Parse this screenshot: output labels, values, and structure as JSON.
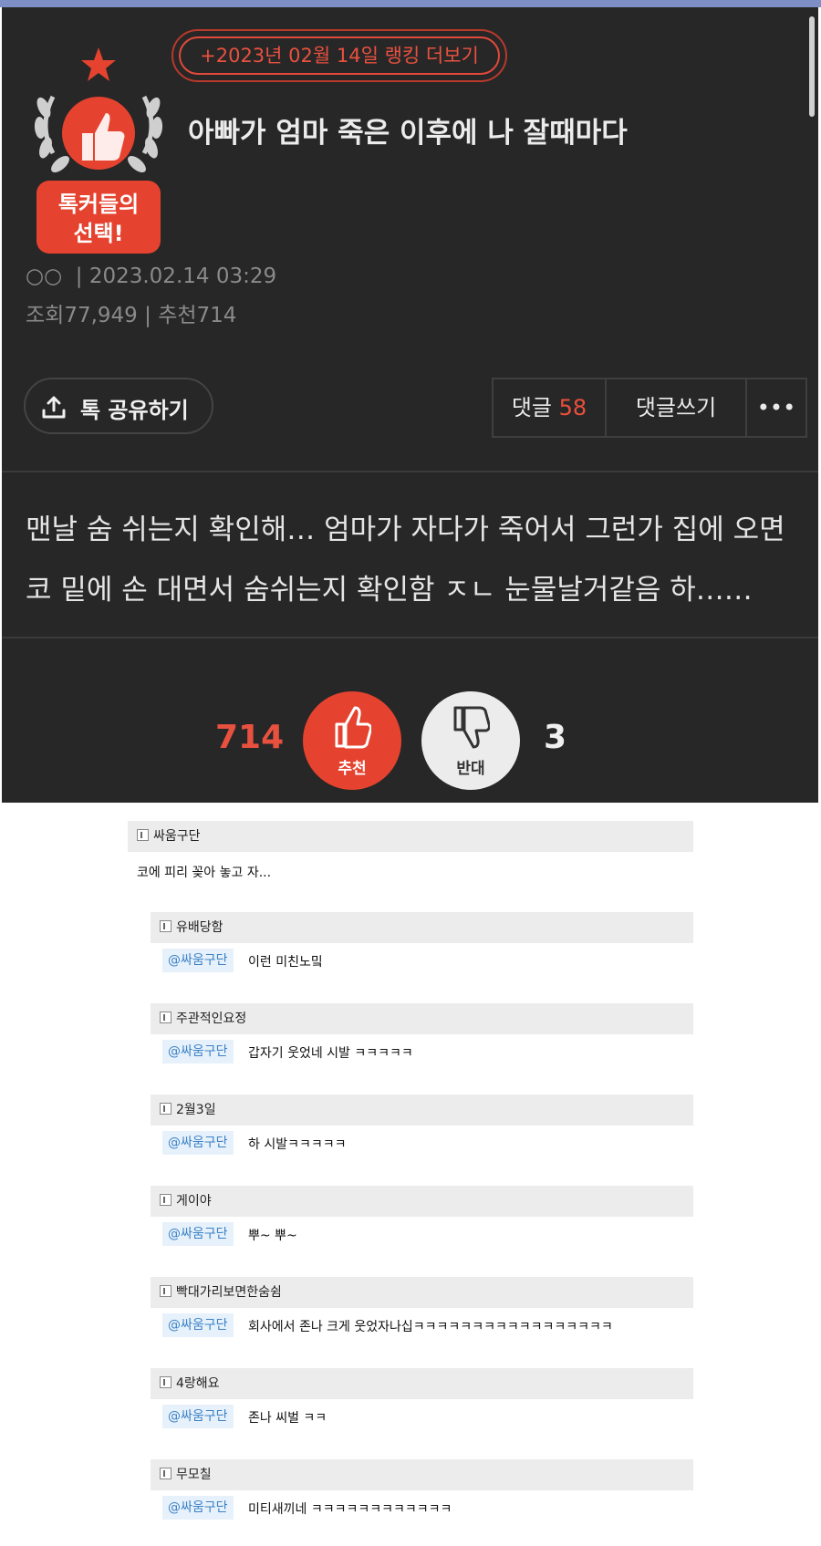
{
  "post": {
    "ranking_link": "+2023년 02월 14일 랭킹 더보기",
    "badge_line1": "톡커들의",
    "badge_line2": "선택!",
    "title": "아빠가 엄마 죽은 이후에 나 잘때마다",
    "author": "○○",
    "datetime": "2023.02.14 03:29",
    "views_label": "조회",
    "views": "77,949",
    "recommend_label": "추천",
    "recommend": "714",
    "share_button": "톡 공유하기",
    "comments_label": "댓글",
    "comments_count": "58",
    "write_comment_button": "댓글쓰기",
    "more_button": "•••",
    "body_line1": "맨날 숨 쉬는지 확인해… 엄마가 자다가 죽어서 그런가 집에 오면",
    "body_line2": "코 밑에 손 대면서 숨쉬는지 확인함 ㅈㄴ 눈물날거같음 하……",
    "upvote_count": "714",
    "upvote_label": "추천",
    "downvote_label": "반대",
    "downvote_count": "3"
  },
  "comments": {
    "top": {
      "user": "싸움구단",
      "text": "코에 피리 꽂아 놓고 자..."
    },
    "replies": [
      {
        "user": "유배당함",
        "mention": "@싸움구단",
        "text": "이런 미친노밐"
      },
      {
        "user": "주관적인요정",
        "mention": "@싸움구단",
        "text": "갑자기 웃었네 시발 ㅋㅋㅋㅋㅋ"
      },
      {
        "user": "2월3일",
        "mention": "@싸움구단",
        "text": "하 시발ㅋㅋㅋㅋㅋ"
      },
      {
        "user": "게이야",
        "mention": "@싸움구단",
        "text": "뿌~ 뿌~"
      },
      {
        "user": "빡대가리보면한숨쉼",
        "mention": "@싸움구단",
        "text": "회사에서 존나 크게 웃었자나십ㅋㅋㅋㅋㅋㅋㅋㅋㅋㅋㅋㅋㅋㅋㅋㅋㅋ"
      },
      {
        "user": "4랑해요",
        "mention": "@싸움구단",
        "text": "존나 씨벌 ㅋㅋ"
      },
      {
        "user": "무모칠",
        "mention": "@싸움구단",
        "text": "미티새끼네 ㅋㅋㅋㅋㅋㅋㅋㅋㅋㅋㅋㅋ"
      }
    ]
  },
  "colors": {
    "accent": "#e5432f",
    "dark_bg": "#272727",
    "mention_bg": "#e6f1fb"
  }
}
